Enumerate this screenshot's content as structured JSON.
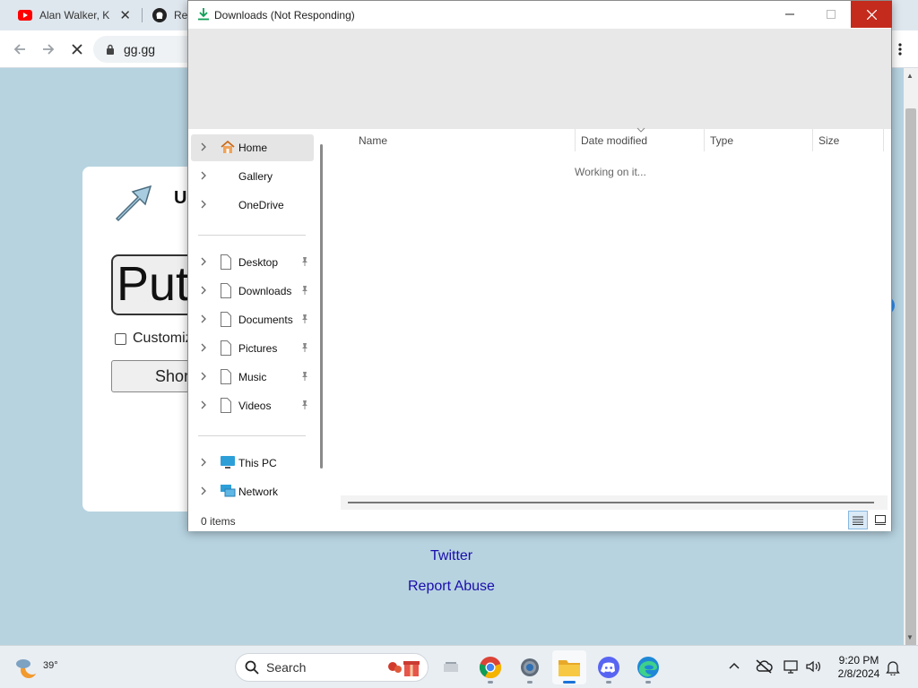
{
  "browser": {
    "tabs": [
      {
        "title": "Alan Walker, K",
        "close": "✕"
      },
      {
        "title": "Rel"
      }
    ],
    "address": "gg.gg"
  },
  "webpage": {
    "card_title": "U",
    "input_value": "Put",
    "checkbox_label": "Customiz",
    "button_label": "Shor",
    "links": [
      "Twitter",
      "Report Abuse"
    ]
  },
  "explorer": {
    "title": "Downloads (Not Responding)",
    "nav": {
      "top": [
        {
          "label": "Home",
          "icon": "home-icon",
          "selected": true
        },
        {
          "label": "Gallery"
        },
        {
          "label": "OneDrive"
        }
      ],
      "quick": [
        {
          "label": "Desktop",
          "pinned": true
        },
        {
          "label": "Downloads",
          "pinned": true
        },
        {
          "label": "Documents",
          "pinned": true
        },
        {
          "label": "Pictures",
          "pinned": true
        },
        {
          "label": "Music",
          "pinned": true
        },
        {
          "label": "Videos",
          "pinned": true
        }
      ],
      "bottom": [
        {
          "label": "This PC",
          "icon": "this-pc-icon"
        },
        {
          "label": "Network",
          "icon": "network-icon"
        }
      ]
    },
    "columns": [
      "Name",
      "Date modified",
      "Type",
      "Size"
    ],
    "status_message": "Working on it...",
    "item_count": "0 items"
  },
  "taskbar": {
    "weather_temp": "39°",
    "search_placeholder": "Search",
    "apps": [
      "task-view",
      "chrome",
      "settings",
      "file-explorer",
      "discord",
      "edge"
    ],
    "active_app": "file-explorer",
    "time": "9:20 PM",
    "date": "2/8/2024"
  },
  "colors": {
    "close_red": "#c42b1c",
    "page_bg": "#b7d3e0",
    "link_blue": "#1a0dab",
    "accent_blue": "#1a73d9"
  }
}
